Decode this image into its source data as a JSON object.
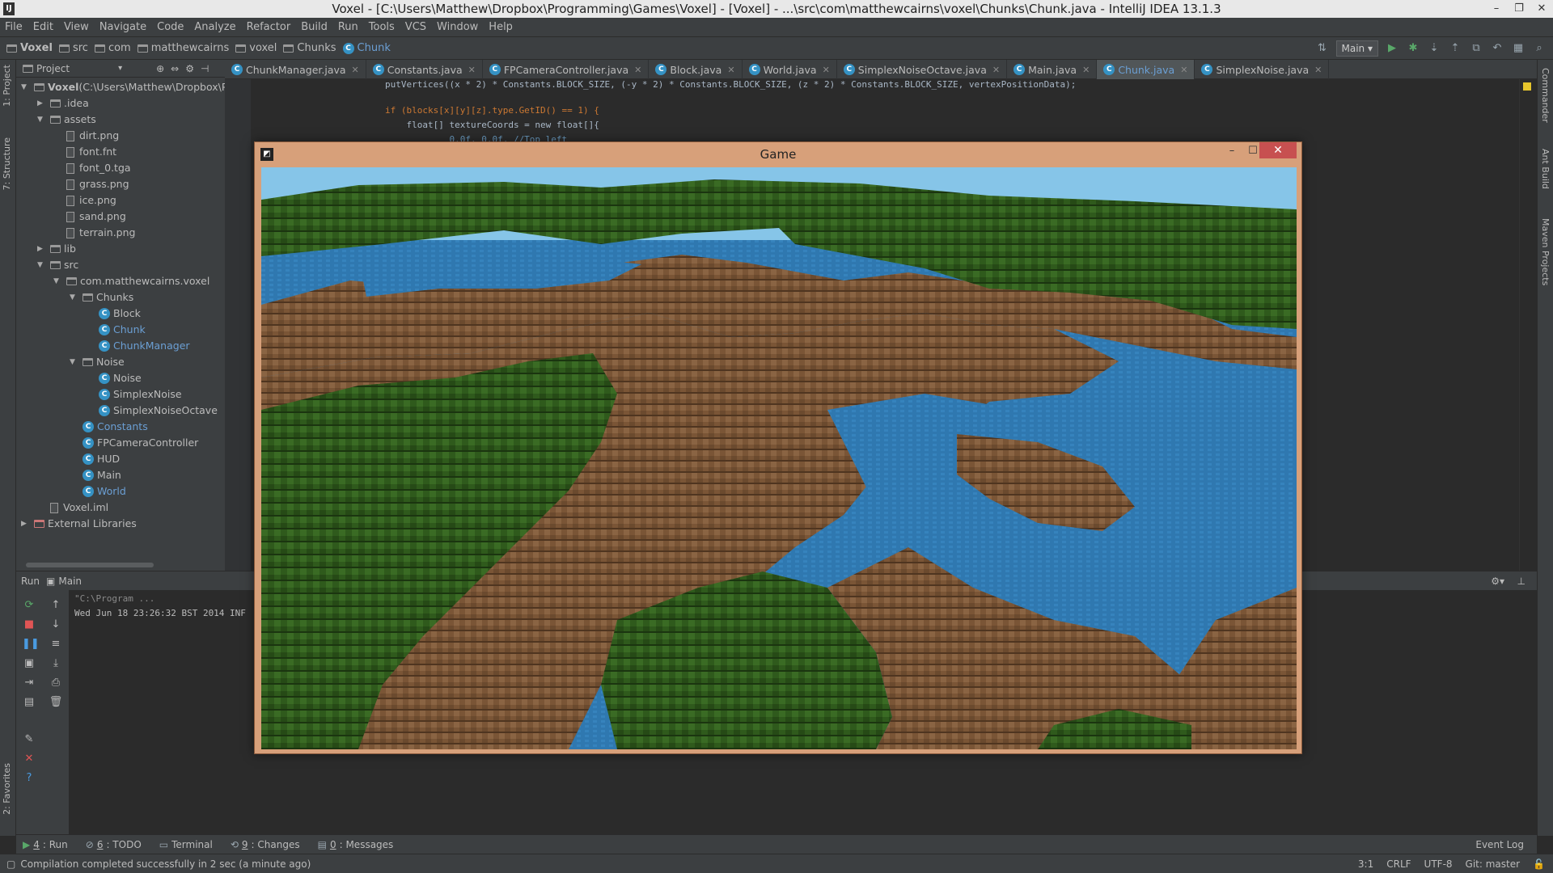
{
  "window": {
    "title": "Voxel - [C:\\Users\\Matthew\\Dropbox\\Programming\\Games\\Voxel] - [Voxel] - ...\\src\\com\\matthewcairns\\voxel\\Chunks\\Chunk.java - IntelliJ IDEA 13.1.3"
  },
  "menu": [
    "File",
    "Edit",
    "View",
    "Navigate",
    "Code",
    "Analyze",
    "Refactor",
    "Build",
    "Run",
    "Tools",
    "VCS",
    "Window",
    "Help"
  ],
  "breadcrumbs": [
    "Voxel",
    "src",
    "com",
    "matthewcairns",
    "voxel",
    "Chunks",
    "Chunk"
  ],
  "toolbar": {
    "run_config": "Main"
  },
  "left_strip": {
    "project": "1: Project",
    "structure": "7: Structure",
    "favorites": "2: Favorites"
  },
  "right_strip": {
    "commander": "Commander",
    "ant": "Ant Build",
    "maven": "Maven Projects"
  },
  "project_panel": {
    "title": "Project",
    "tree": [
      {
        "label": "Voxel",
        "suffix": " (C:\\Users\\Matthew\\Dropbox\\Prog",
        "kind": "module",
        "indent": 0,
        "arrow": "▼"
      },
      {
        "label": ".idea",
        "kind": "folder",
        "indent": 1,
        "arrow": "▶"
      },
      {
        "label": "assets",
        "kind": "folder",
        "indent": 1,
        "arrow": "▼"
      },
      {
        "label": "dirt.png",
        "kind": "file",
        "indent": 2
      },
      {
        "label": "font.fnt",
        "kind": "file",
        "indent": 2
      },
      {
        "label": "font_0.tga",
        "kind": "file",
        "indent": 2
      },
      {
        "label": "grass.png",
        "kind": "file",
        "indent": 2
      },
      {
        "label": "ice.png",
        "kind": "file",
        "indent": 2
      },
      {
        "label": "sand.png",
        "kind": "file",
        "indent": 2
      },
      {
        "label": "terrain.png",
        "kind": "file",
        "indent": 2
      },
      {
        "label": "lib",
        "kind": "folder",
        "indent": 1,
        "arrow": "▶"
      },
      {
        "label": "src",
        "kind": "folder",
        "indent": 1,
        "arrow": "▼"
      },
      {
        "label": "com.matthewcairns.voxel",
        "kind": "folder",
        "indent": 2,
        "arrow": "▼"
      },
      {
        "label": "Chunks",
        "kind": "folder",
        "indent": 3,
        "arrow": "▼"
      },
      {
        "label": "Block",
        "kind": "class",
        "indent": 4
      },
      {
        "label": "Chunk",
        "kind": "class",
        "indent": 4,
        "blue": true
      },
      {
        "label": "ChunkManager",
        "kind": "class",
        "indent": 4,
        "blue": true
      },
      {
        "label": "Noise",
        "kind": "folder",
        "indent": 3,
        "arrow": "▼"
      },
      {
        "label": "Noise",
        "kind": "class",
        "indent": 4
      },
      {
        "label": "SimplexNoise",
        "kind": "class",
        "indent": 4
      },
      {
        "label": "SimplexNoiseOctave",
        "kind": "class",
        "indent": 4
      },
      {
        "label": "Constants",
        "kind": "class",
        "indent": 3,
        "blue": true
      },
      {
        "label": "FPCameraController",
        "kind": "class",
        "indent": 3
      },
      {
        "label": "HUD",
        "kind": "class",
        "indent": 3
      },
      {
        "label": "Main",
        "kind": "class",
        "indent": 3
      },
      {
        "label": "World",
        "kind": "class",
        "indent": 3,
        "blue": true
      },
      {
        "label": "Voxel.iml",
        "kind": "file",
        "indent": 1
      },
      {
        "label": "External Libraries",
        "kind": "lib",
        "indent": 0,
        "arrow": "▶"
      }
    ]
  },
  "editor_tabs": [
    {
      "label": "ChunkManager.java"
    },
    {
      "label": "Constants.java"
    },
    {
      "label": "FPCameraController.java"
    },
    {
      "label": "Block.java"
    },
    {
      "label": "World.java"
    },
    {
      "label": "SimplexNoiseOctave.java"
    },
    {
      "label": "Main.java"
    },
    {
      "label": "Chunk.java",
      "active": true
    },
    {
      "label": "SimplexNoise.java"
    }
  ],
  "code_lines": [
    "putVertices((x * 2) * Constants.BLOCK_SIZE, (-y * 2) * Constants.BLOCK_SIZE, (z * 2) * Constants.BLOCK_SIZE, vertexPositionData);",
    "",
    "if (blocks[x][y][z].type.GetID() == 1) {",
    "    float[] textureCoords = new float[]{",
    "            0.0f, 0.0f, //Top left"
  ],
  "run_panel": {
    "label": "Run",
    "config": "Main",
    "console": [
      "\"C:\\Program ...",
      "Wed Jun 18 23:26:32 BST 2014 INF"
    ]
  },
  "tool_tabs": [
    {
      "num": "4",
      "label": ": Run"
    },
    {
      "num": "6",
      "label": ": TODO"
    },
    {
      "num": "",
      "label": "Terminal"
    },
    {
      "num": "9",
      "label": ": Changes"
    },
    {
      "num": "0",
      "label": ": Messages"
    }
  ],
  "event_log": "Event Log",
  "status": {
    "message": "Compilation completed successfully in 2 sec (a minute ago)",
    "position": "3:1",
    "line_sep": "CRLF",
    "encoding": "UTF-8",
    "vcs": "Git: master"
  },
  "game_window": {
    "title": "Game"
  },
  "colors": {
    "accent": "#3592c4",
    "grass": "#2f5a1c",
    "dirt": "#7a5536",
    "water": "#2f78b0",
    "sky": "#86c5e8"
  }
}
